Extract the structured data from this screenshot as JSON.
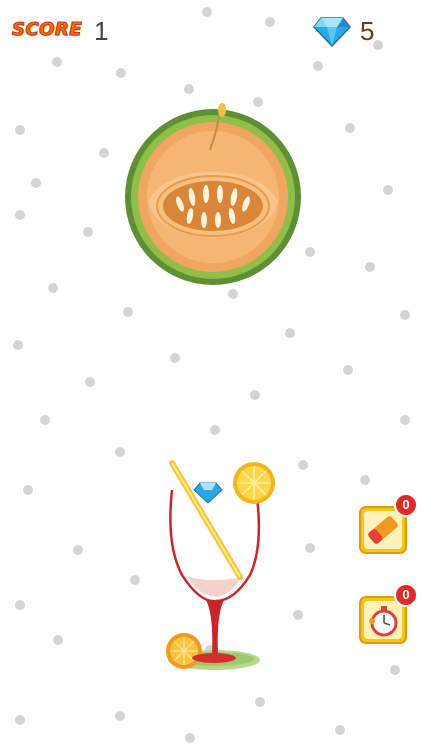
{
  "hud": {
    "score_label": "SCORE",
    "score_value": "1",
    "gem_icon": "diamond-icon",
    "gem_count": "5"
  },
  "target_fruit": {
    "icon": "cantaloupe-half-icon"
  },
  "drink": {
    "icon": "cocktail-glass-icon"
  },
  "powerups": [
    {
      "icon": "eraser-icon",
      "count": "0"
    },
    {
      "icon": "stopwatch-icon",
      "count": "0"
    }
  ],
  "colors": {
    "score_label": "#ff6a12",
    "gem": "#2aa9e0",
    "melon_rind": "#6f9a3a",
    "melon_flesh": "#f3a85e",
    "badge": "#e02a2a",
    "powerup_tile": "#f5c518",
    "dots": "#d4d4d4"
  }
}
